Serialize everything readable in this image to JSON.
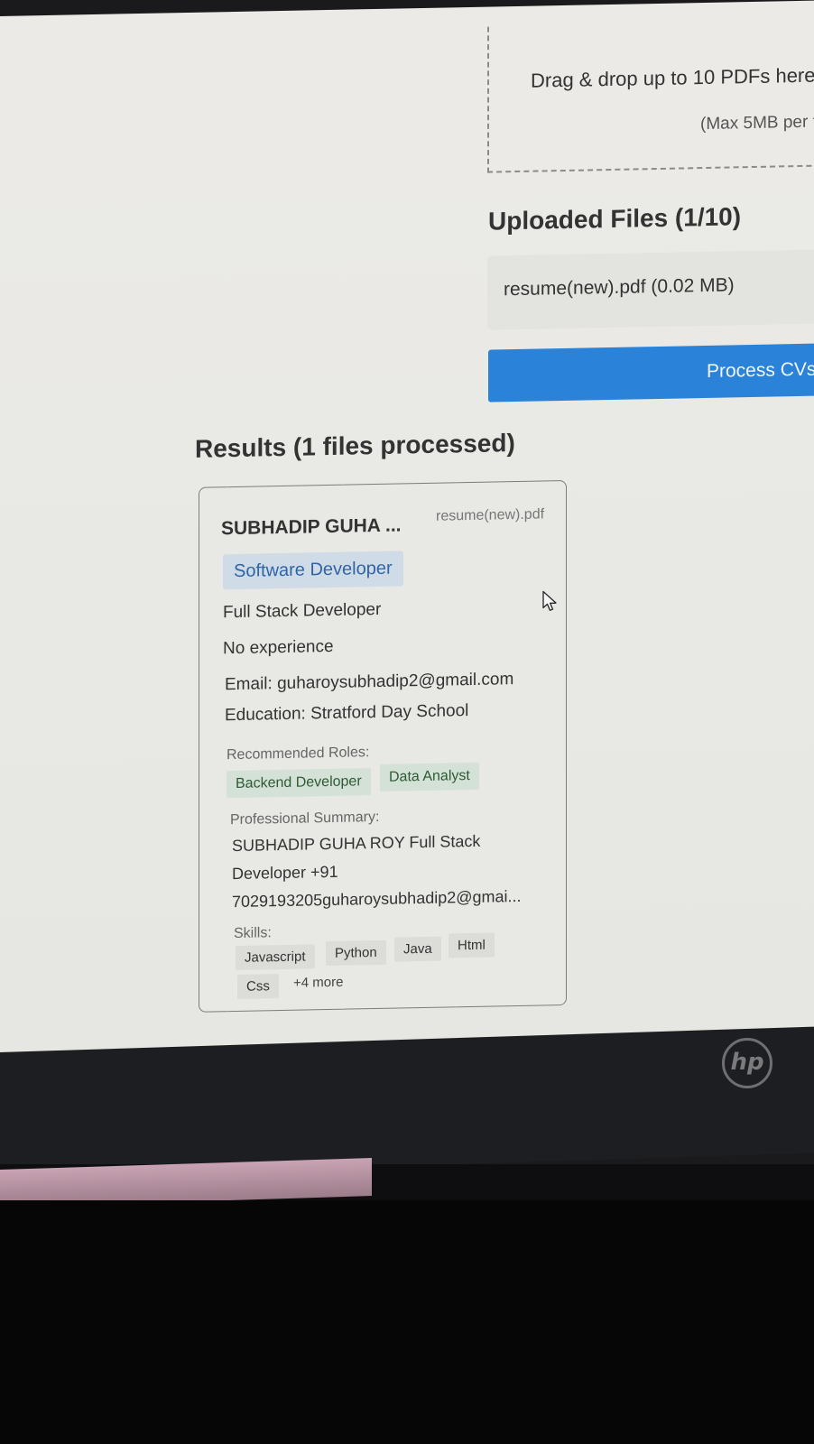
{
  "upload": {
    "drop_title": "Drag & drop up to 10 PDFs here",
    "drop_subtitle": "(Max 5MB per f",
    "heading": "Uploaded Files (1/10)",
    "files": [
      {
        "label": "resume(new).pdf (0.02 MB)"
      }
    ],
    "process_button": "Process CVs"
  },
  "results": {
    "heading": "Results (1 files processed)",
    "card": {
      "name": "SUBHADIP GUHA ...",
      "file": "resume(new).pdf",
      "role": "Software Developer",
      "title": "Full Stack Developer",
      "experience": "No experience",
      "email": "Email: guharoysubhadip2@gmail.com",
      "education": "Education: Stratford Day School",
      "recommended_label": "Recommended Roles:",
      "recommended": [
        "Backend Developer",
        "Data Analyst"
      ],
      "summary_label": "Professional Summary:",
      "summary": "SUBHADIP GUHA ROY Full Stack Developer +91 7029193205guharoysubhadip2@gmai...",
      "skills_label": "Skills:",
      "skills": [
        "Javascript",
        "Python",
        "Java",
        "Html",
        "Css"
      ],
      "skills_more": "+4 more"
    }
  },
  "device": {
    "brand": "hp"
  },
  "colors": {
    "accent": "#2a83d9",
    "role_badge_bg": "#cfdbe6",
    "role_badge_text": "#2f64a6",
    "rec_badge_bg": "#d4e1d6",
    "rec_badge_text": "#2e5b36"
  }
}
